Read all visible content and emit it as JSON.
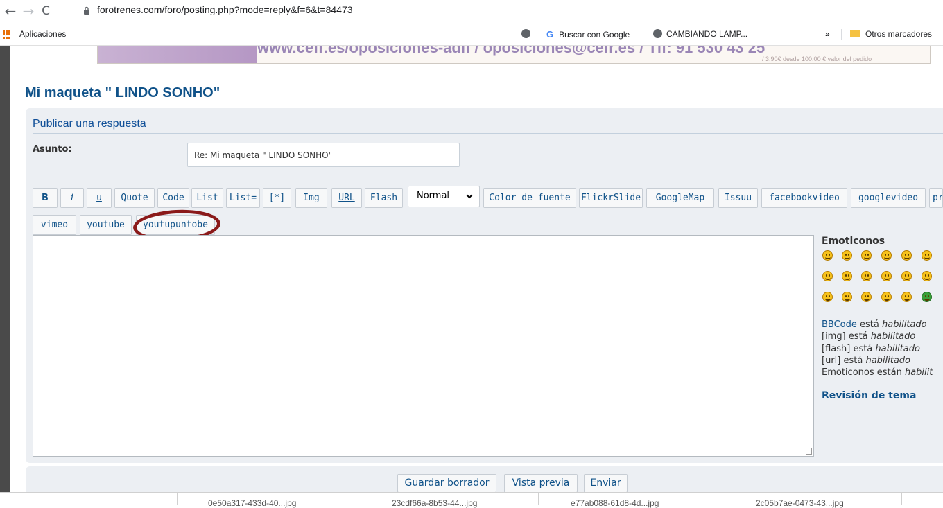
{
  "browser": {
    "url": "forotrenes.com/foro/posting.php?mode=reply&f=6&t=84473",
    "bookmarks": {
      "apps": "Aplicaciones",
      "google_search": "Buscar con Google",
      "cambiando": "CAMBIANDO LAMP...",
      "more": "»",
      "other": "Otros marcadores"
    }
  },
  "banner": {
    "text": "www.cefr.es/oposiciones-adif / oposiciones@cefr.es / Tlf: 91 530 43 25",
    "small": "/ 3,90€ desde 100,00 € valor del pedido"
  },
  "page": {
    "title": "Mi maqueta \" LINDO SONHO\""
  },
  "form": {
    "heading": "Publicar una respuesta",
    "subject_label": "Asunto:",
    "subject_value": "Re: Mi maqueta \" LINDO SONHO\"",
    "toolbar": {
      "b": "B",
      "i": "i",
      "u": "u",
      "quote": "Quote",
      "code": "Code",
      "list": "List",
      "list_eq": "List=",
      "star": "[*]",
      "img": "Img",
      "url": "URL",
      "flash": "Flash",
      "size": "Normal",
      "color": "Color de fuente",
      "flickr": "FlickrSlide",
      "gmap": "GoogleMap",
      "issuu": "Issuu",
      "fbvideo": "facebookvideo",
      "gvideo": "googlevideo",
      "pr": "pr",
      "vimeo": "vimeo",
      "youtube": "youtube",
      "youtupuntobe": "youtupuntobe"
    },
    "smilies_title": "Emoticonos",
    "info": {
      "bbcode_label": "BBCode",
      "bbcode_text": "está",
      "bbcode_state": "habilitado",
      "img": "[img] está",
      "img_state": "habilitado",
      "flash": "[flash] está",
      "flash_state": "habilitado",
      "url": "[url] está",
      "url_state": "habilitado",
      "emot": "Emoticonos están",
      "emot_state": "habilit"
    },
    "review": "Revisión de tema",
    "buttons": {
      "save_draft": "Guardar borrador",
      "preview": "Vista previa",
      "submit": "Enviar"
    }
  },
  "downloads": [
    "0e50a317-433d-40...jpg",
    "23cdf66a-8b53-44...jpg",
    "e77ab088-61d8-4d...jpg",
    "2c05b7ae-0473-43...jpg"
  ]
}
